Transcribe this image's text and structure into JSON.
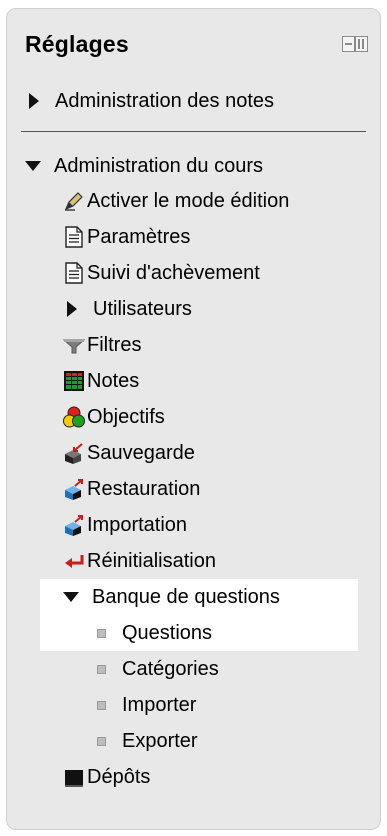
{
  "block": {
    "title": "Réglages",
    "items": {
      "grades_admin": "Administration des notes",
      "course_admin": "Administration du cours",
      "edit_mode": "Activer le mode édition",
      "settings": "Paramètres",
      "completion": "Suivi d'achèvement",
      "users": "Utilisateurs",
      "filters": "Filtres",
      "grades": "Notes",
      "outcomes": "Objectifs",
      "backup": "Sauvegarde",
      "restore": "Restauration",
      "import": "Importation",
      "reset": "Réinitialisation",
      "question_bank": "Banque de questions",
      "questions": "Questions",
      "categories": "Catégories",
      "import_questions": "Importer",
      "export_questions": "Exporter",
      "repositories": "Dépôts"
    }
  },
  "colors": {
    "panel_bg": "#e8e8e8",
    "highlight_bg": "#ffffff",
    "notes_icon": "#1a9b2a",
    "reset_icon": "#c81e1e"
  }
}
